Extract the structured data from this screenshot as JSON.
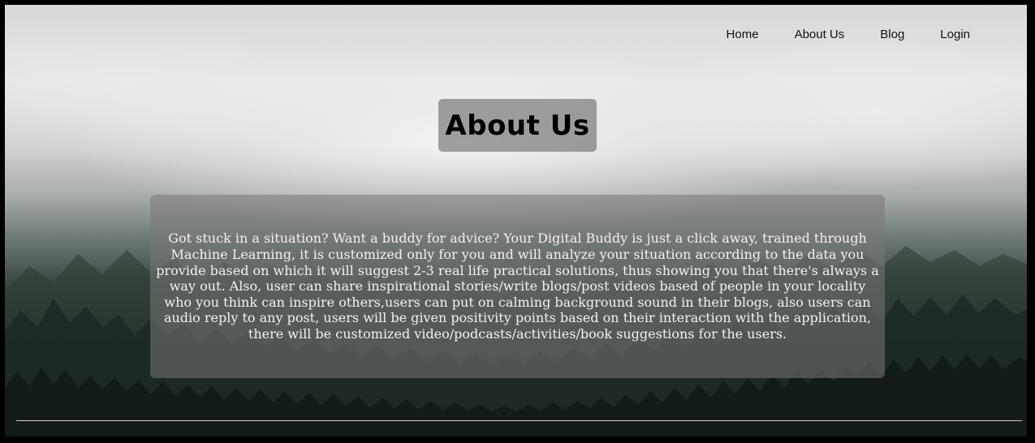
{
  "nav": {
    "items": [
      {
        "label": "Home"
      },
      {
        "label": "About Us"
      },
      {
        "label": "Blog"
      },
      {
        "label": "Login"
      }
    ]
  },
  "hero": {
    "title": "About Us",
    "description": "Got stuck in a situation? Want a buddy for advice? Your Digital Buddy is just a click away, trained through Machine Learning, it is customized only for you and will analyze your situation according to the data you provide based on which it will suggest 2-3 real life practical solutions, thus showing you that there's always a way out. Also, user can share inspirational stories/write blogs/post videos based of people in your locality who you think can inspire others,users can put on calming background sound in their blogs, also users can audio reply to any post, users will be given positivity points based on their interaction with the application, there will be customized video/podcasts/activities/book suggestions for the users."
  },
  "colors": {
    "title_box": "#5a5a5a",
    "description_box": "#787878",
    "nav_text": "#111111"
  }
}
